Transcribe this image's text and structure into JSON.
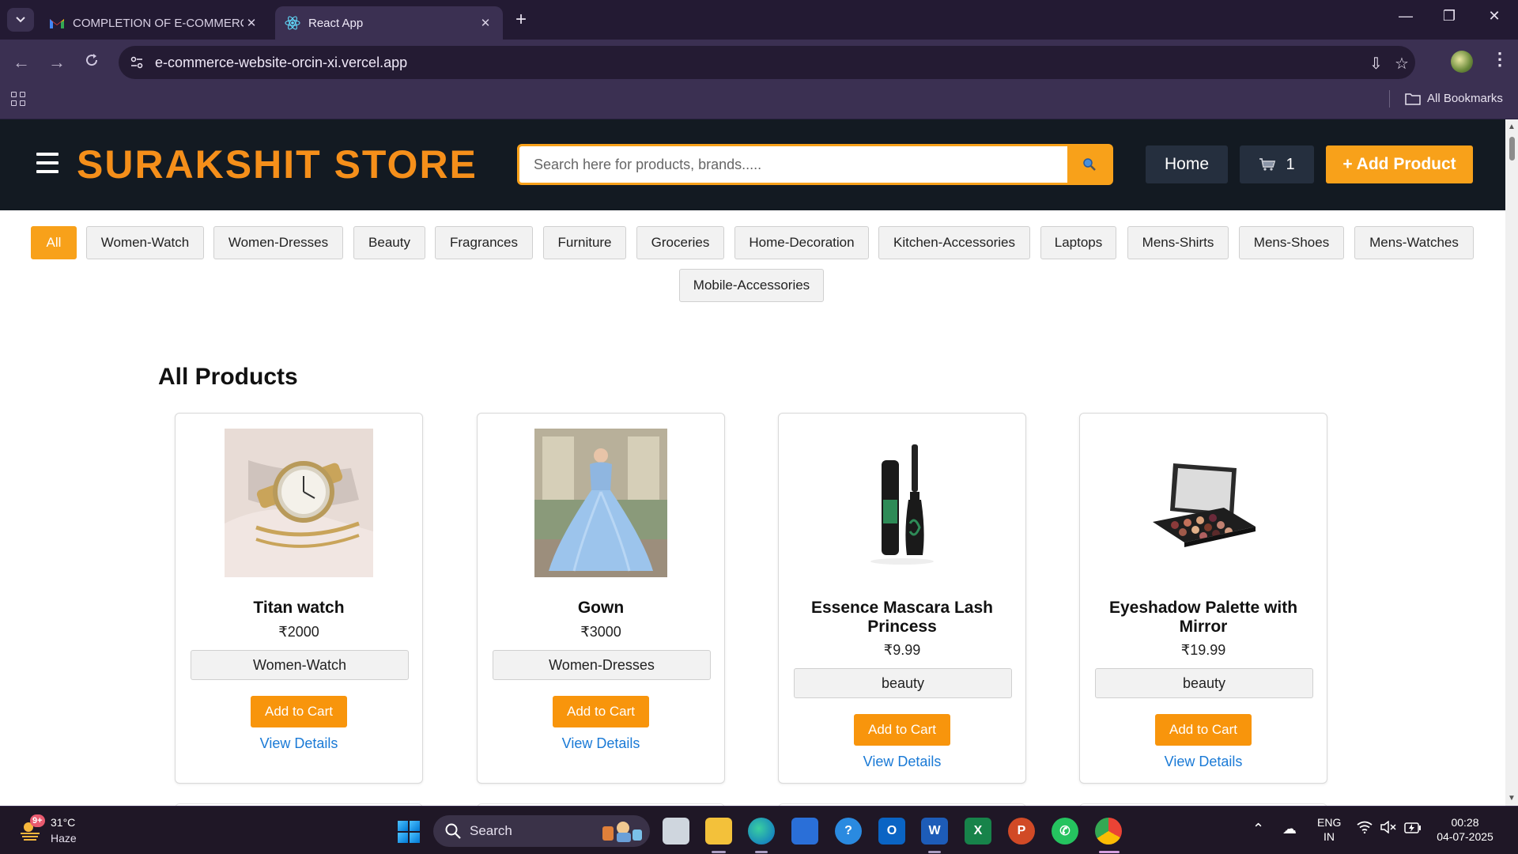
{
  "browser": {
    "tabs": [
      {
        "title": "COMPLETION OF E-COMMERCE",
        "icon": "gmail-icon",
        "active": false
      },
      {
        "title": "React App",
        "icon": "react-icon",
        "active": true
      }
    ],
    "url": "e-commerce-website-orcin-xi.vercel.app",
    "bookmarks_label": "All Bookmarks"
  },
  "navbar": {
    "brand": "SURAKSHIT STORE",
    "search_placeholder": "Search here for products, brands.....",
    "home_label": "Home",
    "cart_count": "1",
    "add_product_label": "+ Add Product"
  },
  "categories": [
    {
      "label": "All",
      "active": true
    },
    {
      "label": "Women-Watch"
    },
    {
      "label": "Women-Dresses"
    },
    {
      "label": "Beauty"
    },
    {
      "label": "Fragrances"
    },
    {
      "label": "Furniture"
    },
    {
      "label": "Groceries"
    },
    {
      "label": "Home-Decoration"
    },
    {
      "label": "Kitchen-Accessories"
    },
    {
      "label": "Laptops"
    },
    {
      "label": "Mens-Shirts"
    },
    {
      "label": "Mens-Shoes"
    },
    {
      "label": "Mens-Watches"
    },
    {
      "label": "Mobile-Accessories"
    }
  ],
  "section_title": "All Products",
  "products": [
    {
      "name": "Titan watch",
      "price": "₹2000",
      "category": "Women-Watch",
      "cart_label": "Add to Cart",
      "details_label": "View Details",
      "image": "watch-image"
    },
    {
      "name": "Gown",
      "price": "₹3000",
      "category": "Women-Dresses",
      "cart_label": "Add to Cart",
      "details_label": "View Details",
      "image": "gown-image"
    },
    {
      "name": "Essence Mascara Lash Princess",
      "price": "₹9.99",
      "category": "beauty",
      "cart_label": "Add to Cart",
      "details_label": "View Details",
      "image": "mascara-image"
    },
    {
      "name": "Eyeshadow Palette with Mirror",
      "price": "₹19.99",
      "category": "beauty",
      "cart_label": "Add to Cart",
      "details_label": "View Details",
      "image": "eyeshadow-palette-image"
    }
  ],
  "taskbar": {
    "weather_badge": "9+",
    "weather_temp": "31°C",
    "weather_desc": "Haze",
    "search_label": "Search",
    "lang_line1": "ENG",
    "lang_line2": "IN",
    "time": "00:28",
    "date": "04-07-2025"
  },
  "colors": {
    "brand": "#f58f1a",
    "accent": "#f8a11a",
    "navbar_bg": "#131a22",
    "link": "#1a7ad6"
  }
}
